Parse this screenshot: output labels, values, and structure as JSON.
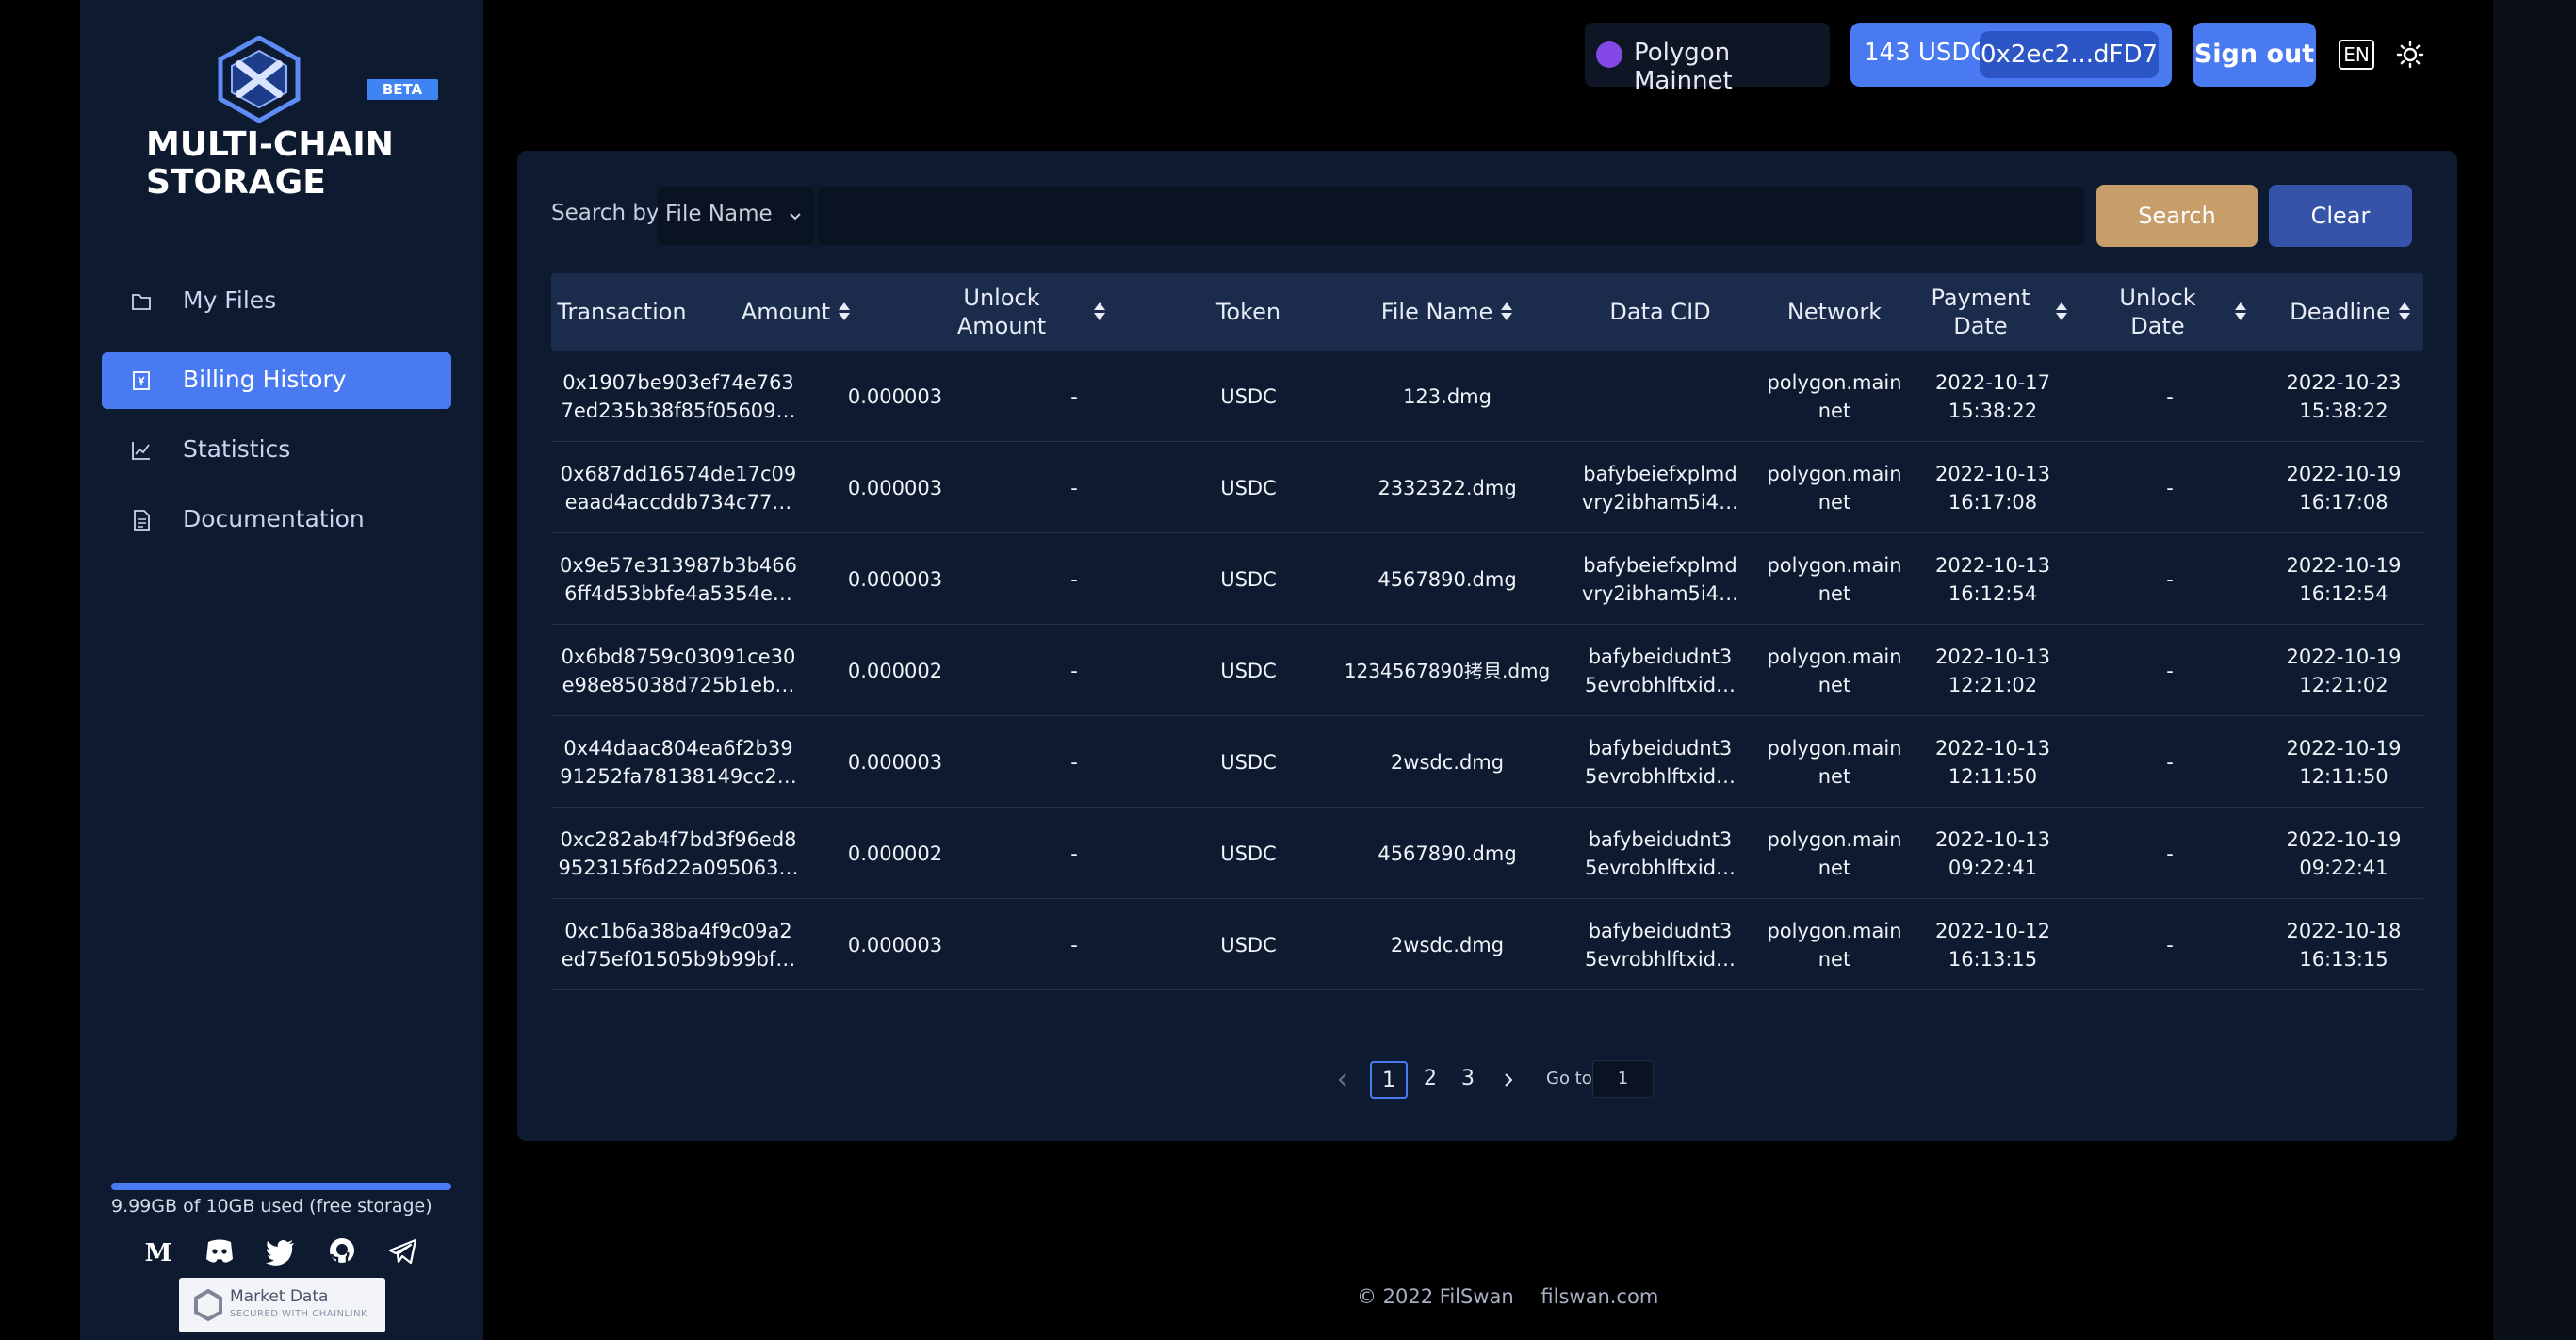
{
  "sidebar": {
    "beta": "BETA",
    "brand_line1": "MULTI-CHAIN",
    "brand_line2": "STORAGE",
    "nav": [
      {
        "label": "My Files",
        "icon": "folder-icon"
      },
      {
        "label": "Billing History",
        "icon": "billing-icon",
        "active": true
      },
      {
        "label": "Statistics",
        "icon": "chart-icon"
      },
      {
        "label": "Documentation",
        "icon": "document-icon"
      }
    ],
    "storage_used_fraction": 0.999,
    "storage_text": "9.99GB of 10GB used (free storage)",
    "socials": [
      "medium-icon",
      "discord-icon",
      "twitter-icon",
      "github-icon",
      "telegram-icon"
    ],
    "chainlink_line1": "Market Data",
    "chainlink_line2": "SECURED WITH CHAINLINK"
  },
  "header": {
    "network": "Polygon Mainnet",
    "balance": "143 USDC",
    "address": "0x2ec2...dFD7",
    "signout": "Sign out",
    "lang": "EN"
  },
  "search": {
    "label": "Search by",
    "field": "File Name",
    "query": "",
    "search_btn": "Search",
    "clear_btn": "Clear"
  },
  "table": {
    "columns": [
      "Transaction",
      "Amount",
      "Unlock\nAmount",
      "Token",
      "File Name",
      "Data CID",
      "Network",
      "Payment\nDate",
      "Unlock\nDate",
      "Deadline"
    ],
    "rows": [
      {
        "tx1": "0x1907be903ef74e763",
        "tx2": "7ed235b38f85f05609…",
        "amount": "0.000003",
        "unlock_amount": "-",
        "token": "USDC",
        "file": "123.dmg",
        "cid1": "",
        "cid2": "",
        "net1": "polygon.main",
        "net2": "net",
        "pay1": "2022-10-17",
        "pay2": "15:38:22",
        "unlock": "-",
        "dl1": "2022-10-23",
        "dl2": "15:38:22"
      },
      {
        "tx1": "0x687dd16574de17c09",
        "tx2": "eaad4accddb734c77…",
        "amount": "0.000003",
        "unlock_amount": "-",
        "token": "USDC",
        "file": "2332322.dmg",
        "cid1": "bafybeiefxplmd",
        "cid2": "vry2ibham5i4…",
        "net1": "polygon.main",
        "net2": "net",
        "pay1": "2022-10-13",
        "pay2": "16:17:08",
        "unlock": "-",
        "dl1": "2022-10-19",
        "dl2": "16:17:08"
      },
      {
        "tx1": "0x9e57e313987b3b466",
        "tx2": "6ff4d53bbfe4a5354e…",
        "amount": "0.000003",
        "unlock_amount": "-",
        "token": "USDC",
        "file": "4567890.dmg",
        "cid1": "bafybeiefxplmd",
        "cid2": "vry2ibham5i4…",
        "net1": "polygon.main",
        "net2": "net",
        "pay1": "2022-10-13",
        "pay2": "16:12:54",
        "unlock": "-",
        "dl1": "2022-10-19",
        "dl2": "16:12:54"
      },
      {
        "tx1": "0x6bd8759c03091ce30",
        "tx2": "e98e85038d725b1eb…",
        "amount": "0.000002",
        "unlock_amount": "-",
        "token": "USDC",
        "file": "1234567890拷貝.dmg",
        "cid1": "bafybeidudnt3",
        "cid2": "5evrobhlftxid…",
        "net1": "polygon.main",
        "net2": "net",
        "pay1": "2022-10-13",
        "pay2": "12:21:02",
        "unlock": "-",
        "dl1": "2022-10-19",
        "dl2": "12:21:02"
      },
      {
        "tx1": "0x44daac804ea6f2b39",
        "tx2": "91252fa78138149cc2…",
        "amount": "0.000003",
        "unlock_amount": "-",
        "token": "USDC",
        "file": "2wsdc.dmg",
        "cid1": "bafybeidudnt3",
        "cid2": "5evrobhlftxid…",
        "net1": "polygon.main",
        "net2": "net",
        "pay1": "2022-10-13",
        "pay2": "12:11:50",
        "unlock": "-",
        "dl1": "2022-10-19",
        "dl2": "12:11:50"
      },
      {
        "tx1": "0xc282ab4f7bd3f96ed8",
        "tx2": "952315f6d22a095063…",
        "amount": "0.000002",
        "unlock_amount": "-",
        "token": "USDC",
        "file": "4567890.dmg",
        "cid1": "bafybeidudnt3",
        "cid2": "5evrobhlftxid…",
        "net1": "polygon.main",
        "net2": "net",
        "pay1": "2022-10-13",
        "pay2": "09:22:41",
        "unlock": "-",
        "dl1": "2022-10-19",
        "dl2": "09:22:41"
      },
      {
        "tx1": "0xc1b6a38ba4f9c09a2",
        "tx2": "ed75ef01505b9b99bf…",
        "amount": "0.000003",
        "unlock_amount": "-",
        "token": "USDC",
        "file": "2wsdc.dmg",
        "cid1": "bafybeidudnt3",
        "cid2": "5evrobhlftxid…",
        "net1": "polygon.main",
        "net2": "net",
        "pay1": "2022-10-12",
        "pay2": "16:13:15",
        "unlock": "-",
        "dl1": "2022-10-18",
        "dl2": "16:13:15"
      }
    ]
  },
  "pagination": {
    "pages": [
      "1",
      "2",
      "3"
    ],
    "current": "1",
    "goto_label": "Go to",
    "goto_value": "1"
  },
  "footer": {
    "copyright": "© 2022 FilSwan",
    "site": "filswan.com"
  },
  "colors": {
    "accent": "#4a7af2",
    "search_btn": "#c79d6a",
    "clear_btn": "#3553a8",
    "sidebar_bg": "#0d1a30",
    "polygon": "#8247e5"
  }
}
